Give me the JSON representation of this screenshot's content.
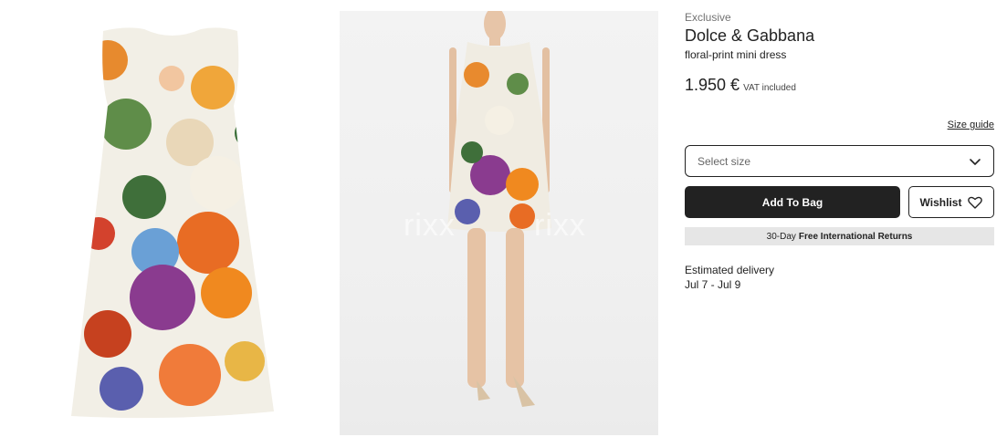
{
  "product": {
    "tag": "Exclusive",
    "brand": "Dolce & Gabbana",
    "name": "floral-print mini dress",
    "price": "1.950 €",
    "vat_note": "VAT included"
  },
  "size": {
    "guide_label": "Size guide",
    "placeholder": "Select size"
  },
  "actions": {
    "add_to_bag": "Add To Bag",
    "wishlist": "Wishlist"
  },
  "returns": {
    "prefix": "30-Day",
    "bold": "Free International Returns"
  },
  "delivery": {
    "label": "Estimated delivery",
    "dates": "Jul 7 - Jul 9"
  },
  "watermark": {
    "text_1": "rixx",
    "text_2": "rixx",
    "text_3": "xx"
  },
  "icons": {
    "dropdown": "chevron-down-icon",
    "wishlist": "heart-icon"
  },
  "colors": {
    "primary": "#222222",
    "returns_bg": "#e6e6e6"
  }
}
